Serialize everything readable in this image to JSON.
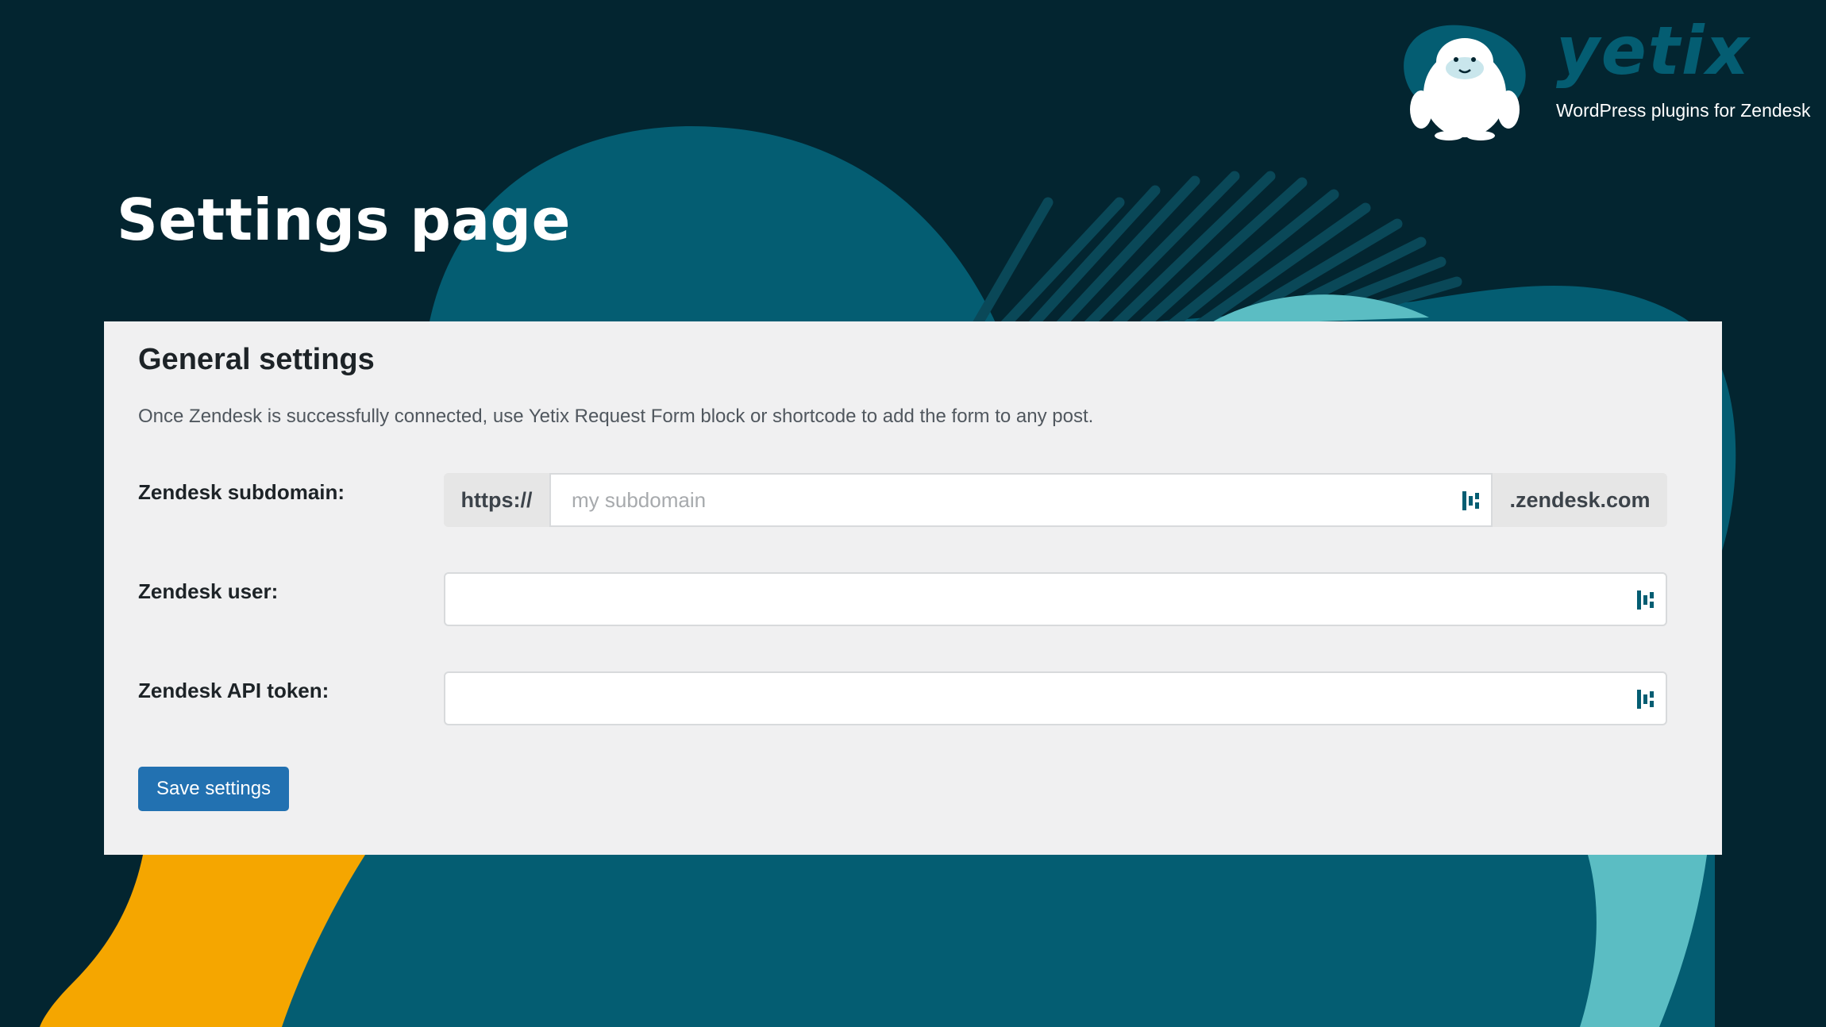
{
  "brand": {
    "name": "yetix",
    "tagline": "WordPress plugins for Zendesk"
  },
  "page": {
    "title": "Settings page"
  },
  "general_settings": {
    "title": "General settings",
    "description": "Once Zendesk is successfully connected, use Yetix Request Form block or shortcode to add the form to any post.",
    "fields": {
      "subdomain": {
        "label": "Zendesk subdomain:",
        "prefix": "https://",
        "placeholder": "my subdomain",
        "value": "",
        "suffix": ".zendesk.com",
        "icon": "password-manager-icon"
      },
      "user": {
        "label": "Zendesk user:",
        "value": "",
        "icon": "password-manager-icon"
      },
      "api_token": {
        "label": "Zendesk API token:",
        "value": "",
        "icon": "password-manager-icon"
      }
    },
    "save_label": "Save settings"
  },
  "colors": {
    "background": "#032530",
    "teal": "#045d72",
    "light_teal": "#5bbdc3",
    "orange": "#f5a600",
    "panel": "#f0f0f1",
    "button": "#2271b1"
  }
}
